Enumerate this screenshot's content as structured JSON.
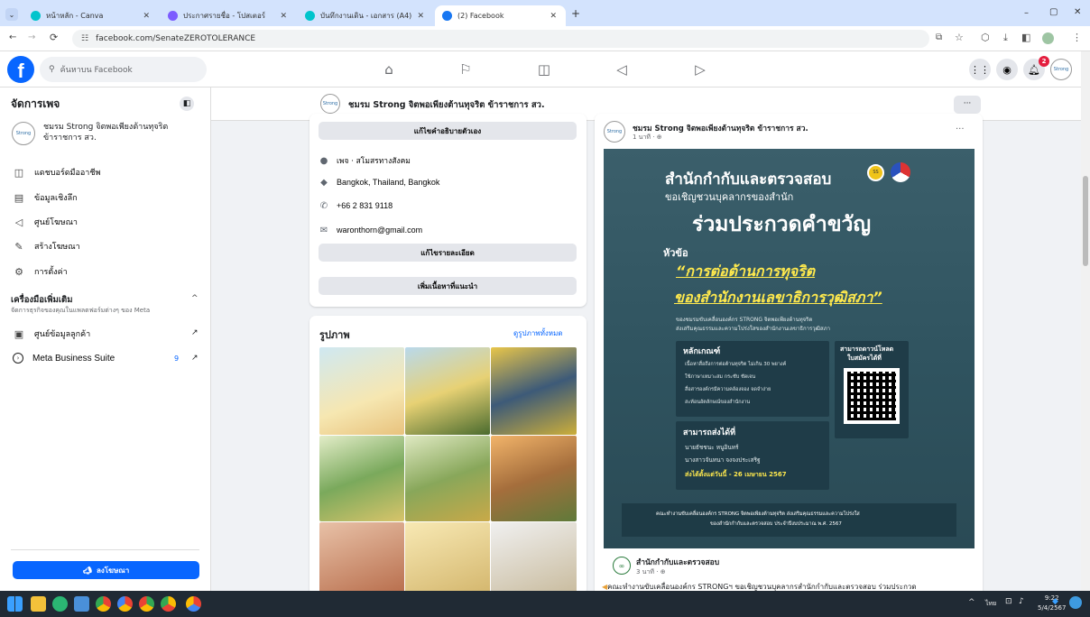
{
  "browser": {
    "tabs": [
      {
        "title": "หน้าหลัก - Canva",
        "color": "#00c4cc"
      },
      {
        "title": "ประกาศรายชื่อ - โปสเตอร์",
        "color": "#7c5cff"
      },
      {
        "title": "บันทึกงานเดิน - เอกสาร (A4)",
        "color": "#00c4cc"
      },
      {
        "title": "(2) Facebook",
        "color": "#1877f2"
      }
    ],
    "url": "facebook.com/SenateZEROTOLERANCE",
    "new_tab": "+"
  },
  "fb": {
    "search_placeholder": "ค้นหาบน Facebook",
    "notif_count": "2"
  },
  "sidebar": {
    "title": "จัดการเพจ",
    "page_name_line1": "ชมรม Strong จิตพอเพียงต้านทุจริต",
    "page_name_line2": "ข้าราชการ สว.",
    "items": [
      {
        "label": "แดชบอร์ดมืออาชีพ",
        "icon": "dashboard-icon"
      },
      {
        "label": "ข้อมูลเชิงลึก",
        "icon": "insights-icon"
      },
      {
        "label": "ศูนย์โฆษณา",
        "icon": "ad-center-icon"
      },
      {
        "label": "สร้างโฆษณา",
        "icon": "create-ad-icon"
      },
      {
        "label": "การตั้งค่า",
        "icon": "gear-icon"
      }
    ],
    "tools_title": "เครื่องมือเพิ่มเติม",
    "tools_sub": "จัดการธุรกิจของคุณในแพลตฟอร์มต่างๆ ของ Meta",
    "tools": [
      {
        "label": "ศูนย์ข้อมูลลูกค้า",
        "badge": ""
      },
      {
        "label": "Meta Business Suite",
        "badge": "9"
      }
    ],
    "promote_label": "ลงโฆษณา"
  },
  "pagebar": {
    "name": "ชมรม Strong จิตพอเพียงต้านทุจริต ข้าราชการ สว."
  },
  "intro": {
    "edit_bio": "แก้ไขคำอธิบายตัวเอง",
    "category": "เพจ · สโมสรทางสังคม",
    "location": "Bangkok, Thailand, Bangkok",
    "phone": "+66 2 831 9118",
    "email": "waronthorn@gmail.com",
    "edit_details": "แก้ไขรายละเอียด",
    "add_featured": "เพิ่มเนื้อหาที่แนะนำ"
  },
  "photos": {
    "title": "รูปภาพ",
    "see_all": "ดูรูปภาพทั้งหมด"
  },
  "post": {
    "author": "ชมรม Strong จิตพอเพียงต้านทุจริต ข้าราชการ สว.",
    "time": "1 นาที · ",
    "more": "···"
  },
  "poster": {
    "line1": "สำนักกำกับและตรวจสอบ",
    "line2": "ขอเชิญชวนบุคลากรของสำนัก",
    "line3": "ร่วมประกวดคำขวัญ",
    "topic_label": "หัวข้อ",
    "topic1": "“การต่อต้านการทุจริต",
    "topic2": "ของสำนักงานเลขาธิการวุฒิสภา”",
    "sub1": "ของชมรมขับเคลื่อนองค์กร STRONG จิตพอเพียงต้านทุจริต",
    "sub2": "ส่งเสริมคุณธรรมและความโปร่งใสของสำนักงานเลขาธิการวุฒิสภา",
    "criteria_title": "หลักเกณฑ์",
    "criteria": [
      "เนื้อหาสื่อถึงการต่อต้านทุจริต ไม่เกิน 30 พยางค์",
      "ใช้ภาษาเหมาะสม กระชับ ชัดเจน",
      "สื่อสารองค์กรมีความคล้องจอง จดจำง่าย",
      "สะท้อนอัตลักษณ์ของสำนักงาน"
    ],
    "download_title1": "สามารถดาวน์โหลด",
    "download_title2": "ใบสมัครได้ที่",
    "submit_title": "สามารถส่งได้ที่",
    "submit": [
      "นายธัชชนะ หนูอินทร์",
      "นางสาวจันทนา จงจงประเสริฐ"
    ],
    "deadline": "ส่งได้ตั้งแต่วันนี้ - 26 เมษายน 2567",
    "footer1": "คณะทำงานขับเคลื่อนองค์กร STRONG จิตพอเพียงต้านทุจริต ส่งเสริมคุณธรรมและความโปร่งใส",
    "footer2": "ของสำนักกำกับและตรวจสอบ ประจำปีงบประมาณ พ.ศ. 2567"
  },
  "shared": {
    "author": "สำนักกำกับและตรวจสอบ",
    "time": "3 นาที · ",
    "text": "คณะทำงานขับเคลื่อนองค์กร STRONGฯ ขอเชิญชวนบุคลากรสำนักกำกับและตรวจสอบ ร่วมประกวด"
  },
  "taskbar": {
    "lang": "ไทย",
    "time": "9:22",
    "date": "5/4/2567"
  },
  "colors": {
    "fb_blue": "#0866ff",
    "poster_bg": "#3b5f6b",
    "poster_accent": "#ffe94d"
  }
}
